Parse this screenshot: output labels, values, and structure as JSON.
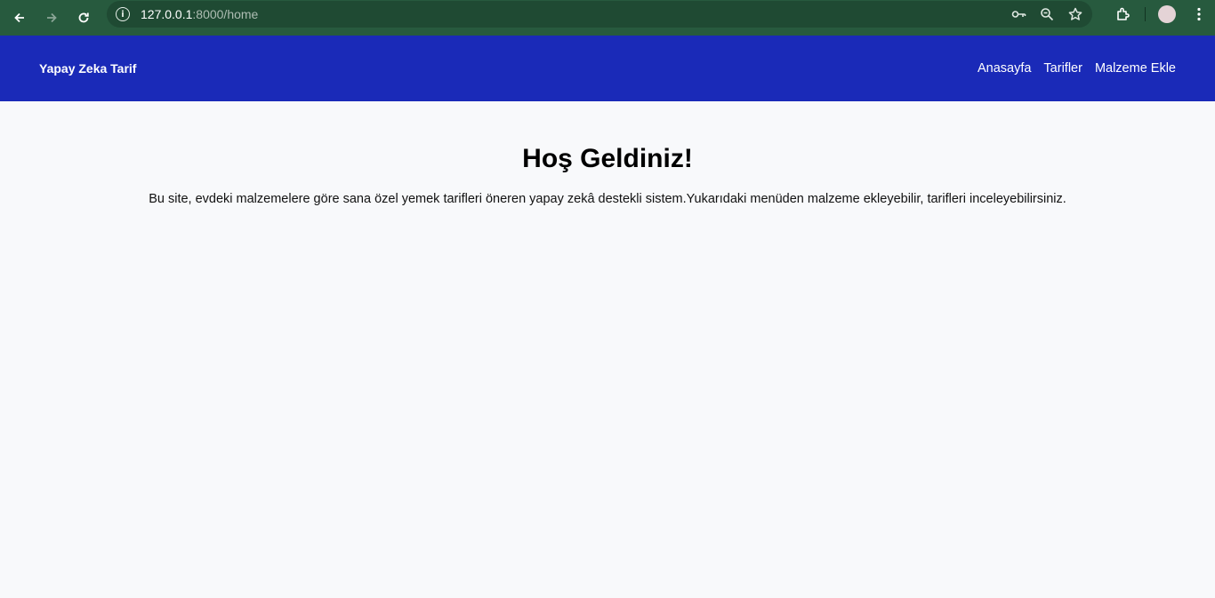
{
  "browser": {
    "url_host": "127.0.0.1",
    "url_path": ":8000/home",
    "icons": [
      "back-icon",
      "forward-icon",
      "reload-icon",
      "info-icon",
      "key-icon",
      "zoom-icon",
      "star-icon",
      "extensions-icon",
      "avatar",
      "menu-icon"
    ],
    "theme_color": "#275a3e"
  },
  "header": {
    "brand": "Yapay Zeka Tarif",
    "nav": [
      "Anasayfa",
      "Tarifler",
      "Malzeme Ekle"
    ],
    "bg_color": "#1a2ab8"
  },
  "main": {
    "title": "Hoş Geldiniz!",
    "description": "Bu site, evdeki malzemelere göre sana özel yemek tarifleri öneren yapay zekâ destekli sistem.Yukarıdaki menüden malzeme ekleyebilir, tarifleri inceleyebilirsiniz."
  }
}
